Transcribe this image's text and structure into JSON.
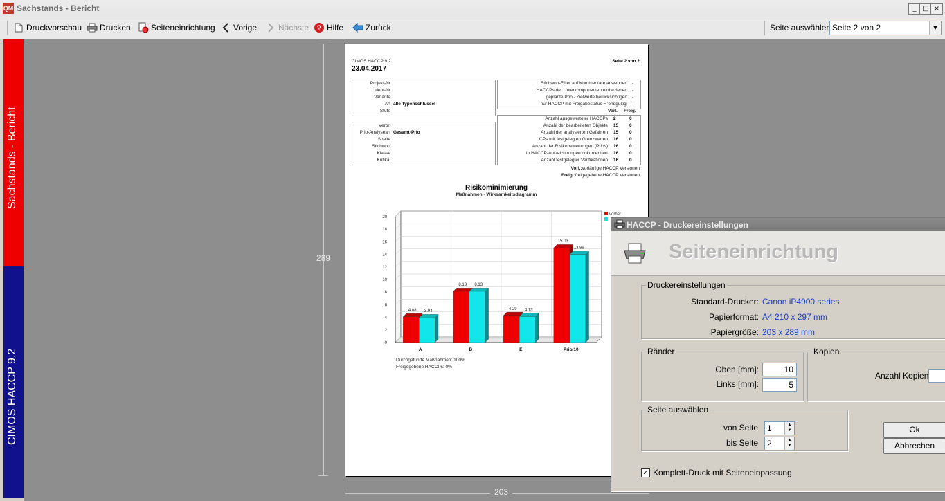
{
  "window": {
    "app_icon_text": "QM",
    "title": "Sachstands - Bericht",
    "controls": [
      "_",
      "□",
      "×"
    ]
  },
  "toolbar": {
    "print_preview": "Druckvorschau",
    "print": "Drucken",
    "page_setup": "Seiteneinrichtung",
    "previous": "Vorige",
    "next": "Nächste",
    "help": "Hilfe",
    "back": "Zurück",
    "page_select_label": "Seite auswählen",
    "page_select_value": "Seite 2 von 2"
  },
  "sidebar": {
    "top_text": "Sachstands - Bericht",
    "bottom_text": "CIMOS HACCP 9.2",
    "top_color": "#ee0000",
    "bottom_color": "#11118e"
  },
  "preview": {
    "height_label": "289",
    "width_label": "203"
  },
  "report": {
    "product": "CIMOS HACCP 9.2",
    "date": "23.04.2017",
    "page": "Seite 2 von 2",
    "left_table_1": [
      {
        "label": "Projekt-Nr",
        "value": ""
      },
      {
        "label": "Ident-Nr",
        "value": ""
      },
      {
        "label": "Variante",
        "value": ""
      },
      {
        "label": "Art",
        "value": "alle Typenschlussel"
      },
      {
        "label": "Stufe",
        "value": ""
      }
    ],
    "left_table_2": [
      {
        "label": "Verbr.",
        "value": ""
      },
      {
        "label": "Prio-Analyseart",
        "value": "Gesamt-Prio"
      },
      {
        "label": "Spalte",
        "value": ""
      },
      {
        "label": "Stichwort",
        "value": ""
      },
      {
        "label": "Klasse",
        "value": ""
      },
      {
        "label": "Kritikal",
        "value": ""
      }
    ],
    "right_table_1": [
      {
        "label": "Stichwort-Filter auf Kommentare anwenden",
        "value": "-"
      },
      {
        "label": "HACCPs der Unterkomponenten einbeziehen",
        "value": "-"
      },
      {
        "label": "geplante Prio - Zielwerte berücksichtigen",
        "value": "-"
      },
      {
        "label": "nur HACCP mit Freigabestatus = 'endgültig'",
        "value": "-"
      }
    ],
    "right_header": {
      "vorl": "Vorl.",
      "freig": "Freig."
    },
    "right_table_2": [
      {
        "label": "Anzahl ausgewerteter HACCPs",
        "vorl": "2",
        "freig": "0"
      },
      {
        "label": "Anzahl der bearbeiteten Objekte",
        "vorl": "15",
        "freig": "0"
      },
      {
        "label": "Anzahl der analysierten Gefahren",
        "vorl": "15",
        "freig": "0"
      },
      {
        "label": "CPs mit festgelegten Grenzwerten",
        "vorl": "16",
        "freig": "0"
      },
      {
        "label": "Anzahl der Risikobewertungen (Prios)",
        "vorl": "16",
        "freig": "0"
      },
      {
        "label": "In HACCP-Aufzeichnungen dokumentiert",
        "vorl": "16",
        "freig": "0"
      },
      {
        "label": "Anzahl festgelegter Verifikationen",
        "vorl": "16",
        "freig": "0"
      }
    ],
    "legend_notes": [
      {
        "key": "Vorl.:",
        "text": "vorläufige HACCP Versionen"
      },
      {
        "key": "Freig.:",
        "text": "freigegebene HACCP Versionen"
      }
    ],
    "chart_title": "Risikominimierung",
    "chart_subtitle": "Maßnahmen - Wirksamkeitsdiagramm",
    "footer_1": "Durchgeführte Maßnahmen: 100%",
    "footer_2": "Freigegebene HACCPs: 0%"
  },
  "chart_data": {
    "type": "bar",
    "categories": [
      "A",
      "B",
      "E",
      "Prio/10"
    ],
    "series": [
      {
        "name": "vorher",
        "values": [
          4.08,
          8.13,
          4.29,
          15.03
        ],
        "color": "#ee0000"
      },
      {
        "name": "",
        "values": [
          3.94,
          8.13,
          4.13,
          13.99
        ],
        "color": "#11e6ea"
      }
    ],
    "value_labels": [
      [
        "4.08",
        "8.13",
        "4.29",
        "15.03"
      ],
      [
        "3.94",
        "8.13",
        "4.13",
        "13.99"
      ]
    ],
    "y_ticks": [
      "0",
      "2",
      "4",
      "6",
      "8",
      "10",
      "12",
      "14",
      "16",
      "18",
      "20"
    ],
    "ylim": [
      0,
      20
    ],
    "grid": true,
    "legend_position": "top-right"
  },
  "dialog": {
    "title": "HACCP - Druckereinstellungen",
    "header": "Seiteneinrichtung",
    "printer_group": "Druckereinstellungen",
    "standard_printer_label": "Standard-Drucker:",
    "standard_printer_value": "Canon iP4900 series",
    "paper_format_label": "Papierformat:",
    "paper_format_value": "A4 210 x 297 mm",
    "paper_size_label": "Papiergröße:",
    "paper_size_value": "203 x 289 mm",
    "margins_group": "Ränder",
    "top_label": "Oben [mm]:",
    "top_value": "10",
    "left_label": "Links [mm]:",
    "left_value": "5",
    "copies_group": "Kopien",
    "copies_label": "Anzahl Kopien:",
    "copies_value": "",
    "page_group": "Seite auswählen",
    "from_label": "von Seite",
    "from_value": "1",
    "to_label": "bis Seite",
    "to_value": "2",
    "ok": "Ok",
    "cancel": "Abbrechen",
    "fit_checkbox": "Komplett-Druck mit Seiteneinpassung",
    "fit_checked": "✓"
  }
}
